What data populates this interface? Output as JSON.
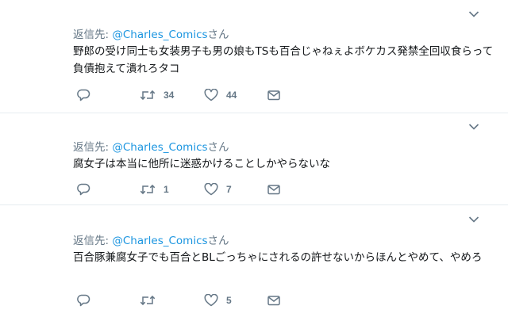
{
  "tweets": [
    {
      "reply_prefix": "返信先: ",
      "reply_handle": "@Charles_Comics",
      "reply_suffix": "さん",
      "text": "野郎の受け同士も女装男子も男の娘もTSも百合じゃねぇよボケカス発禁全回収食らって負債抱えて潰れろタコ",
      "retweets": "34",
      "likes": "44"
    },
    {
      "reply_prefix": "返信先: ",
      "reply_handle": "@Charles_Comics",
      "reply_suffix": "さん",
      "text": "腐女子は本当に他所に迷惑かけることしかやらないな",
      "retweets": "1",
      "likes": "7"
    },
    {
      "reply_prefix": "返信先: ",
      "reply_handle": "@Charles_Comics",
      "reply_suffix": "さん",
      "text": "百合豚兼腐女子でも百合とBLごっちゃにされるの許せないからほんとやめて、やめろ",
      "retweets": "",
      "likes": "5"
    }
  ],
  "icons": {
    "caret": "chevron-down-icon",
    "reply": "reply-icon",
    "retweet": "retweet-icon",
    "like": "heart-icon",
    "dm": "envelope-icon"
  },
  "colors": {
    "text": "#14171a",
    "muted": "#657786",
    "link": "#1b95e0",
    "divider": "#e6ecf0"
  }
}
